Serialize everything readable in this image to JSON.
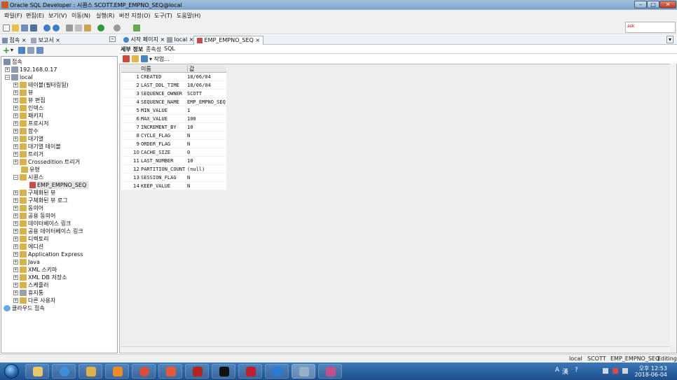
{
  "window": {
    "title": "Oracle SQL Developer : 시퀀스 SCOTT.EMP_EMPNO_SEQ@local",
    "controls": {
      "minimize": "–",
      "maximize": "□",
      "close": "✕"
    }
  },
  "menu": [
    "파일(F)",
    "편집(E)",
    "보기(V)",
    "이동(N)",
    "실행(R)",
    "버전 지정(O)",
    "도구(T)",
    "도움말(H)"
  ],
  "search": {
    "value": "ask"
  },
  "left_tabs": [
    {
      "label": "접속",
      "close": "×"
    },
    {
      "label": "보고서",
      "close": "×"
    }
  ],
  "left_panel_min": "–",
  "left_toolbar": {
    "add": "+",
    "dropdown": "▾"
  },
  "tree": {
    "root_label": "접속",
    "items": [
      {
        "label": "192.168.0.17",
        "exp": "+"
      },
      {
        "label": "local",
        "exp": "−"
      },
      {
        "label": "테이블(필터링됨)",
        "exp": "+"
      },
      {
        "label": "뷰",
        "exp": "+"
      },
      {
        "label": "뷰 편집",
        "exp": "+"
      },
      {
        "label": "인덱스",
        "exp": "+"
      },
      {
        "label": "패키지",
        "exp": "+"
      },
      {
        "label": "프로시저",
        "exp": "+"
      },
      {
        "label": "함수",
        "exp": "+"
      },
      {
        "label": "대기열",
        "exp": "+"
      },
      {
        "label": "대기열 테이블",
        "exp": "+"
      },
      {
        "label": "트리거",
        "exp": "+"
      },
      {
        "label": "Crossedition 트리거",
        "exp": "+"
      },
      {
        "label": "유형",
        "exp": ""
      },
      {
        "label": "시퀀스",
        "exp": "−"
      },
      {
        "label": "EMP_EMPNO_SEQ",
        "exp": ""
      },
      {
        "label": "구체화된 뷰",
        "exp": "+"
      },
      {
        "label": "구체화된 뷰 로그",
        "exp": "+"
      },
      {
        "label": "동의어",
        "exp": "+"
      },
      {
        "label": "공용 동의어",
        "exp": "+"
      },
      {
        "label": "데이터베이스 링크",
        "exp": "+"
      },
      {
        "label": "공용 데이터베이스 링크",
        "exp": "+"
      },
      {
        "label": "디렉토리",
        "exp": "+"
      },
      {
        "label": "에디션",
        "exp": "+"
      },
      {
        "label": "Application Express",
        "exp": "+"
      },
      {
        "label": "Java",
        "exp": "+"
      },
      {
        "label": "XML 스키마",
        "exp": "+"
      },
      {
        "label": "XML DB 저장소",
        "exp": "+"
      },
      {
        "label": "스케줄러",
        "exp": "+"
      },
      {
        "label": "휴지통",
        "exp": "+"
      },
      {
        "label": "다른 사용자",
        "exp": "+"
      },
      {
        "label": "클라우드 접속",
        "exp": ""
      }
    ]
  },
  "doc_tabs": [
    {
      "label": "시작 페이지",
      "close": "×"
    },
    {
      "label": "local",
      "close": "×"
    },
    {
      "label": "EMP_EMPNO_SEQ",
      "close": "×"
    }
  ],
  "doc_tabs_menu": "▾",
  "sub_tabs": [
    "세부 정보",
    "종속성",
    "SQL"
  ],
  "grid_toolbar": {
    "actions_label": "▾ 작업..."
  },
  "grid": {
    "columns": [
      "이름",
      "값"
    ],
    "rows": [
      {
        "num": "1",
        "name": "CREATED",
        "value": "18/06/04"
      },
      {
        "num": "2",
        "name": "LAST_DDL_TIME",
        "value": "18/06/04"
      },
      {
        "num": "3",
        "name": "SEQUENCE_OWNER",
        "value": "SCOTT"
      },
      {
        "num": "4",
        "name": "SEQUENCE_NAME",
        "value": "EMP_EMPNO_SEQ"
      },
      {
        "num": "5",
        "name": "MIN_VALUE",
        "value": "1"
      },
      {
        "num": "6",
        "name": "MAX_VALUE",
        "value": "100"
      },
      {
        "num": "7",
        "name": "INCREMENT_BY",
        "value": "10"
      },
      {
        "num": "8",
        "name": "CYCLE_FLAG",
        "value": "N"
      },
      {
        "num": "9",
        "name": "ORDER_FLAG",
        "value": "N"
      },
      {
        "num": "10",
        "name": "CACHE_SIZE",
        "value": "0"
      },
      {
        "num": "11",
        "name": "LAST_NUMBER",
        "value": "10"
      },
      {
        "num": "12",
        "name": "PARTITION_COUNT",
        "value": "(null)"
      },
      {
        "num": "13",
        "name": "SESSION_FLAG",
        "value": "N"
      },
      {
        "num": "14",
        "name": "KEEP_VALUE",
        "value": "N"
      }
    ]
  },
  "status": {
    "connection": "local",
    "owner": "SCOTT",
    "object": "EMP_EMPNO_SEQ",
    "mode": "Editing"
  },
  "taskbar": {
    "apps": [
      "folder",
      "internet-explorer",
      "file-explorer",
      "media-player",
      "chrome",
      "gallery",
      "acrobat",
      "terminal",
      "filezilla",
      "vscode",
      "sql-developer",
      "network-tool"
    ],
    "tray": {
      "lang": "A",
      "hanja": "漢",
      "help": "?",
      "clock_time": "오후 12:53",
      "clock_date": "2018-06-04"
    }
  }
}
